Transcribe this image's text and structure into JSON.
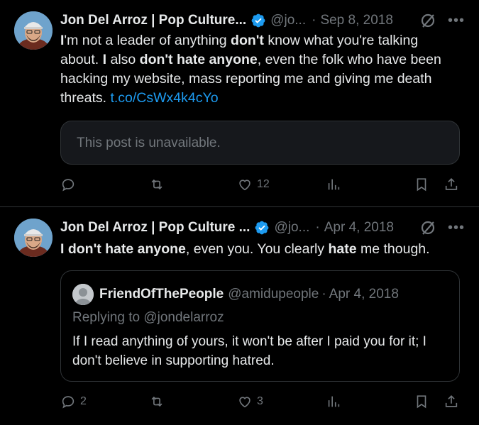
{
  "tweets": [
    {
      "name": "Jon Del Arroz | Pop Culture...",
      "handle": "@jo...",
      "date": "Sep 8, 2018",
      "text": {
        "p1": "I",
        "p2": "'m not a leader of anything ",
        "p3": "don't",
        "p4": " know what you're talking about. ",
        "p5": "I",
        "p6": " also ",
        "p7": "don't hate anyone",
        "p8": ", even the folk who have been hacking my website, mass reporting me and giving me death threats. ",
        "link": "t.co/CsWx4k4cYo"
      },
      "unavailable": "This post is unavailable.",
      "replies": "",
      "retweets": "",
      "likes": "12"
    },
    {
      "name": "Jon Del Arroz | Pop Culture ...",
      "handle": "@jo...",
      "date": "Apr 4, 2018",
      "text": {
        "p1": "I don't hate anyone",
        "p2": ", even you. You clearly ",
        "p3": "hate",
        "p4": " me though."
      },
      "quote": {
        "name": "FriendOfThePeople",
        "handle": "@amidupeople",
        "date": "Apr 4, 2018",
        "reply_to": "Replying to @jondelarroz",
        "text": "If I read anything of yours, it won't be after I paid you for it; I don't believe in supporting hatred."
      },
      "replies": "2",
      "retweets": "",
      "likes": "3"
    }
  ],
  "colors": {
    "background": "#000000",
    "text": "#e7e9ea",
    "muted": "#71767b",
    "link": "#1d9bf0",
    "border": "#2f3336",
    "verified": "#1d9bf0"
  }
}
